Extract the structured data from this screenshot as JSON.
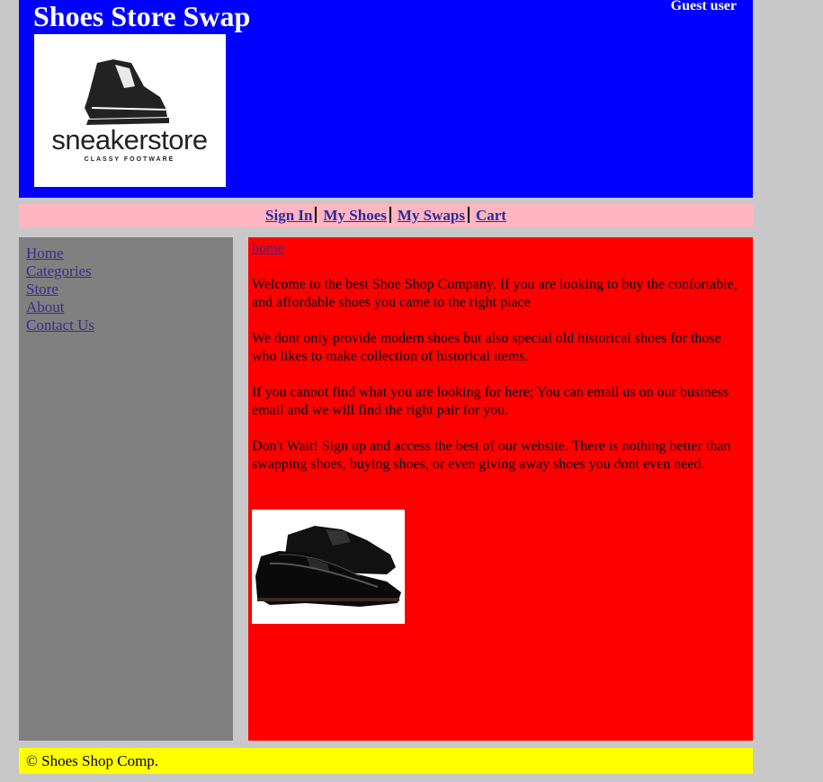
{
  "header": {
    "title": "Shoes Store Swap",
    "user": "Guest user",
    "logo": {
      "brand": "sneakerstore",
      "tagline": "CLASSY FOOTWARE"
    }
  },
  "topnav": {
    "items": [
      "Sign In",
      "My Shoes",
      "My Swaps",
      "Cart"
    ]
  },
  "sidebar": {
    "items": [
      "Home",
      "Categories",
      "Store",
      "About",
      "Contact Us"
    ]
  },
  "content": {
    "breadcrumb": "home",
    "paragraphs": [
      "Welcome to the best Shoe Shop Company. If you are looking to buy the confortable, and affordable shoes you came to the right place",
      "We dont only provide modern shoes but also special old historical shoes for those who likes to make collection of historical items.",
      "If you cannot find what you are looking for here; You can email us on our business email and we will find the right pair for you.",
      "Don't Wait! Sign up and access the best of our website. There is nothing better than swapping shoes, buying shoes, or even giving away shoes you dont even need."
    ]
  },
  "footer": {
    "text": "© Shoes Shop Comp."
  },
  "colors": {
    "header_bg": "#0000ff",
    "nav_bg": "#ffb6c1",
    "sidebar_bg": "#808080",
    "content_bg": "#ff0000",
    "footer_bg": "#ffff00"
  }
}
